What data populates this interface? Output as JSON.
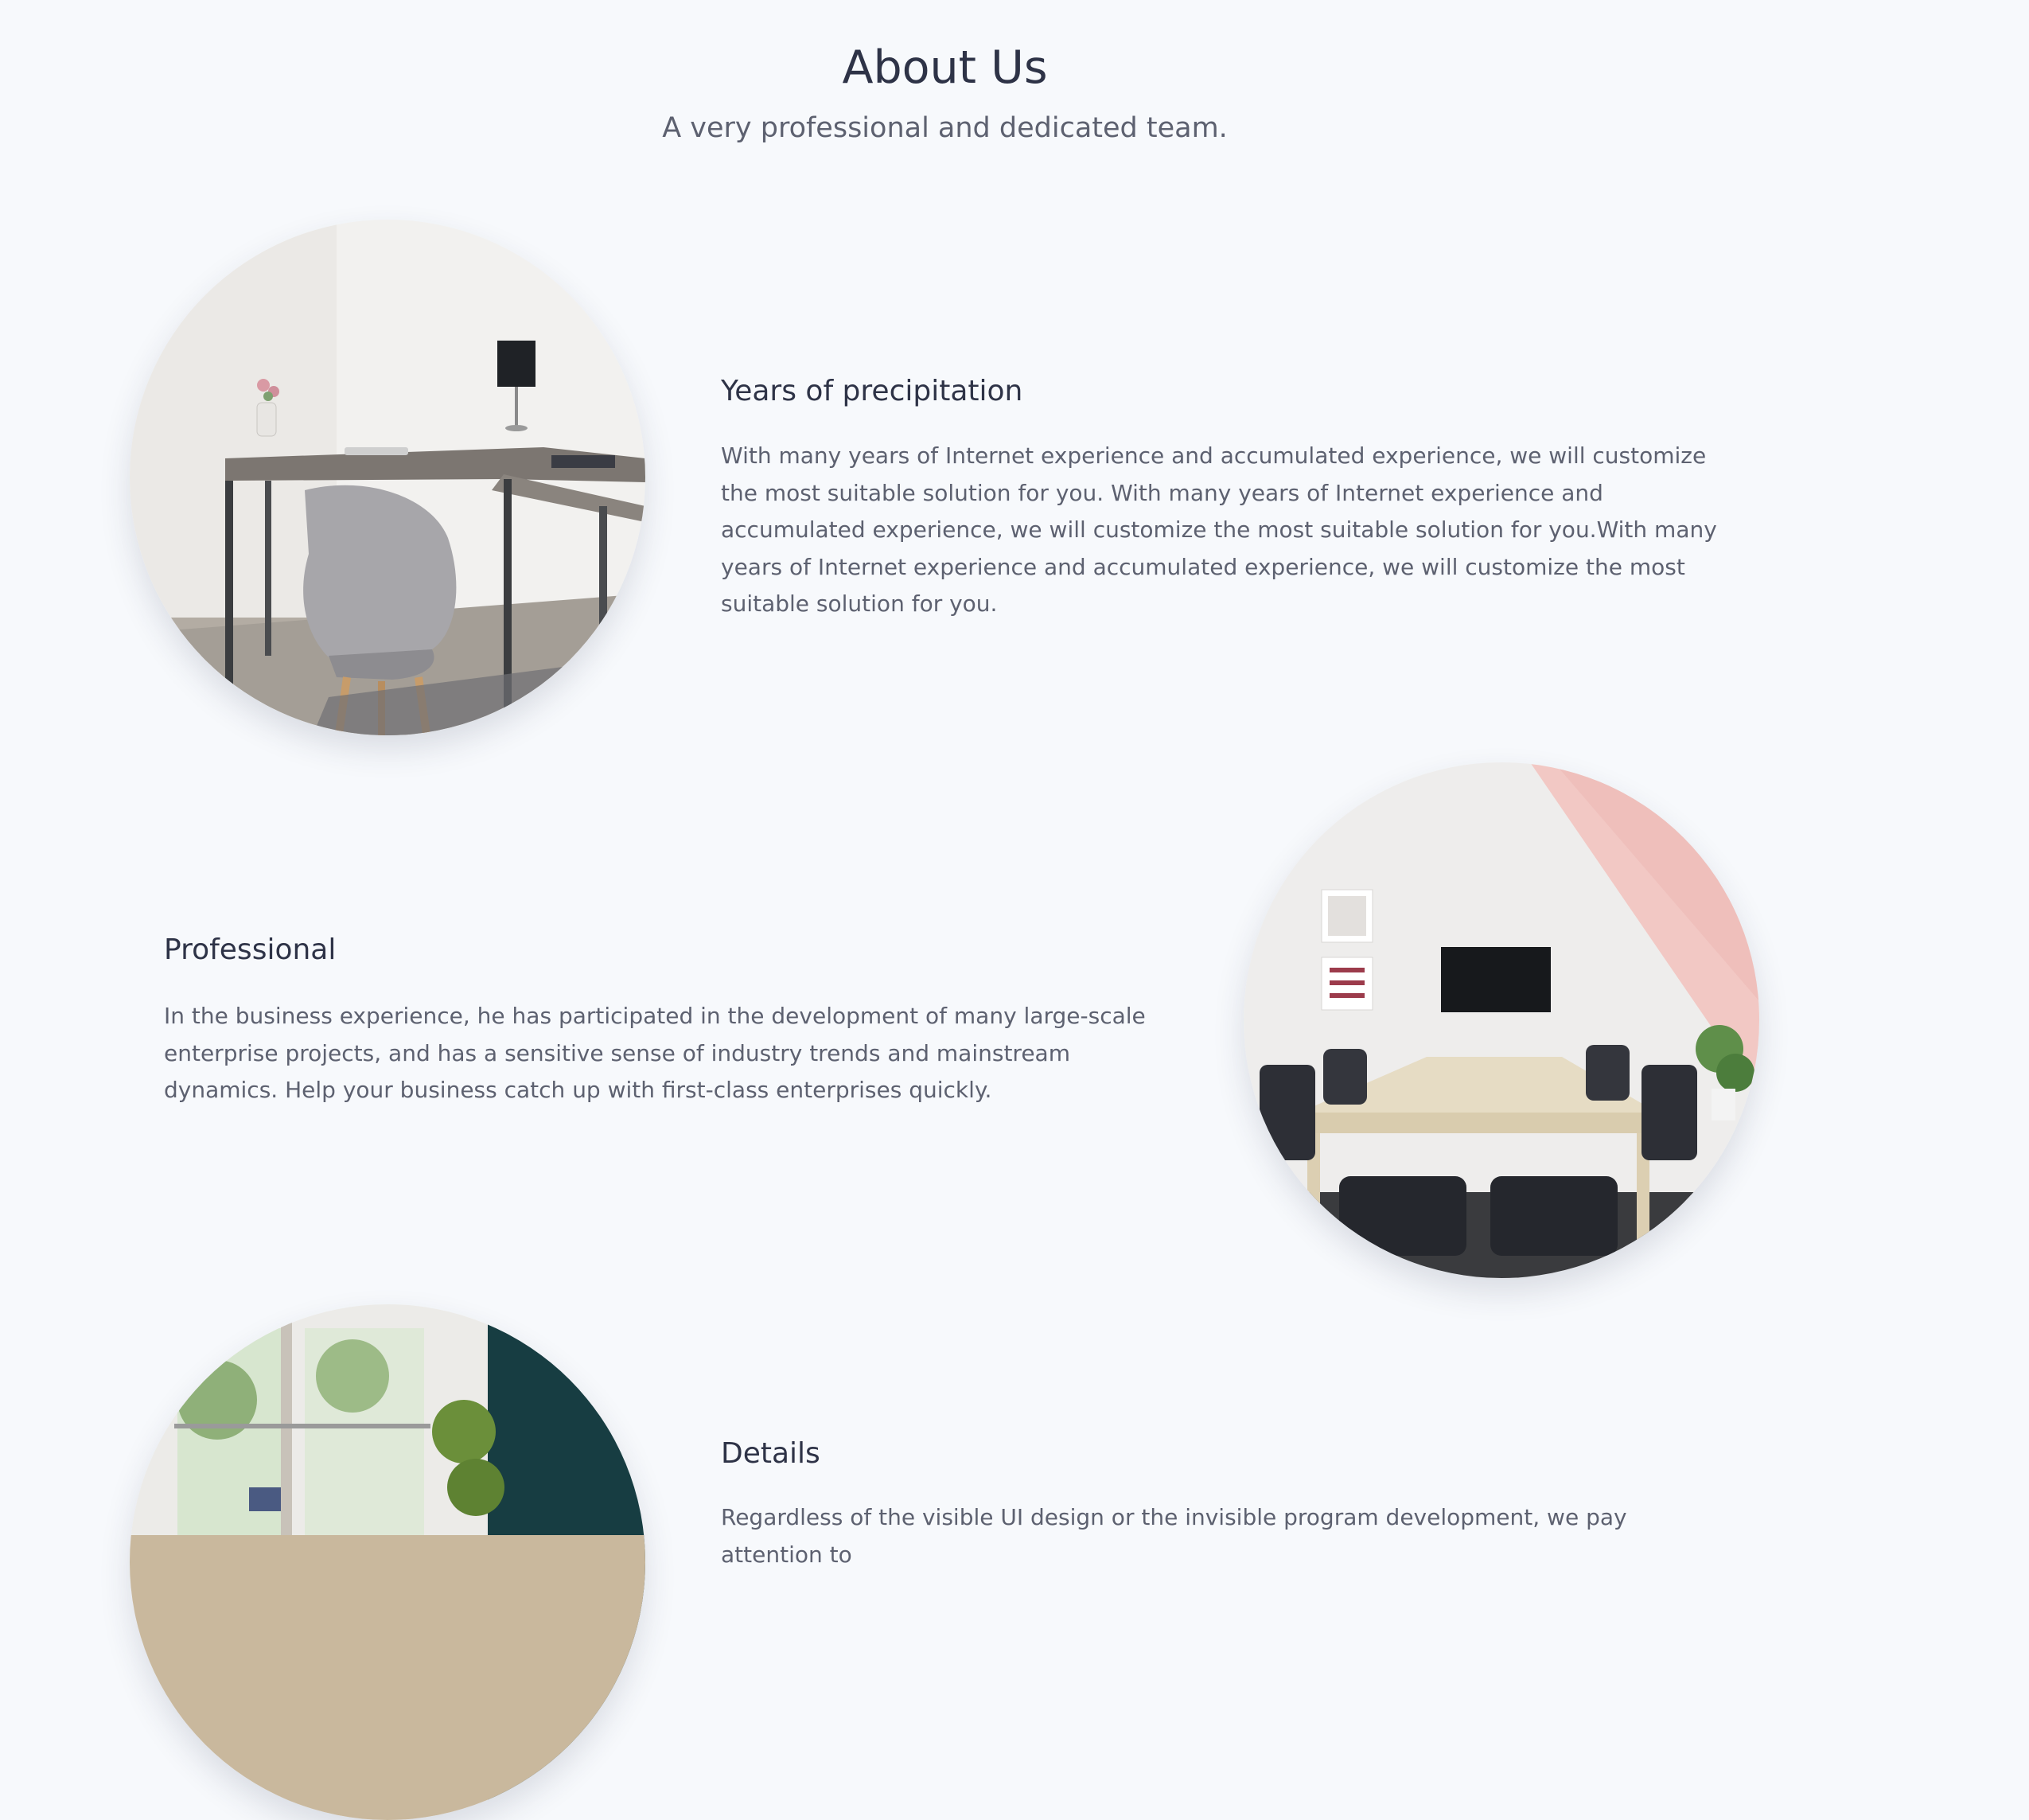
{
  "header": {
    "title": "About Us",
    "subtitle": "A very professional and dedicated team."
  },
  "sections": [
    {
      "title": "Years of precipitation",
      "text": "With many years of Internet experience and accumulated experience, we will customize the most suitable solution for you. With many years of Internet experience and accumulated experience, we will customize the most suitable solution for you.With many years of Internet experience and accumulated experience, we will customize the most suitable solution for you.",
      "image": "office-desk-chair-photo"
    },
    {
      "title": "Professional",
      "text": "In the business experience, he has participated in the development of many large-scale enterprise projects, and has a sensitive sense of industry trends and mainstream dynamics. Help your business catch up with first-class enterprises quickly.",
      "image": "meeting-room-photo"
    },
    {
      "title": "Details",
      "text": "Regardless of the visible UI design or the invisible program development, we pay attention to",
      "image": "office-interior-photo"
    }
  ],
  "colors": {
    "background": "#f7f9fc",
    "heading": "#2e3347",
    "body_text": "#5d6170"
  }
}
